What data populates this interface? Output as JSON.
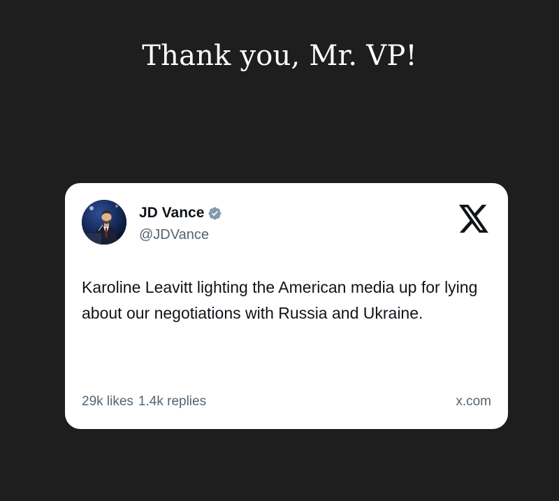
{
  "headline": "Thank you, Mr. VP!",
  "tweet": {
    "author": {
      "name": "JD Vance",
      "handle": "@JDVance",
      "verified": true,
      "avatar_icon": "profile-photo"
    },
    "platform_icon": "x-logo-icon",
    "text": "Karoline Leavitt lighting the American media up for lying about our negotiations with Russia and Ukraine.",
    "likes": "29k likes",
    "replies": "1.4k replies",
    "source": "x.com"
  },
  "colors": {
    "background": "#1e1e1f",
    "card": "#ffffff",
    "text_primary": "#0f1419",
    "text_secondary": "#536471",
    "verified_badge": "#829aab"
  }
}
